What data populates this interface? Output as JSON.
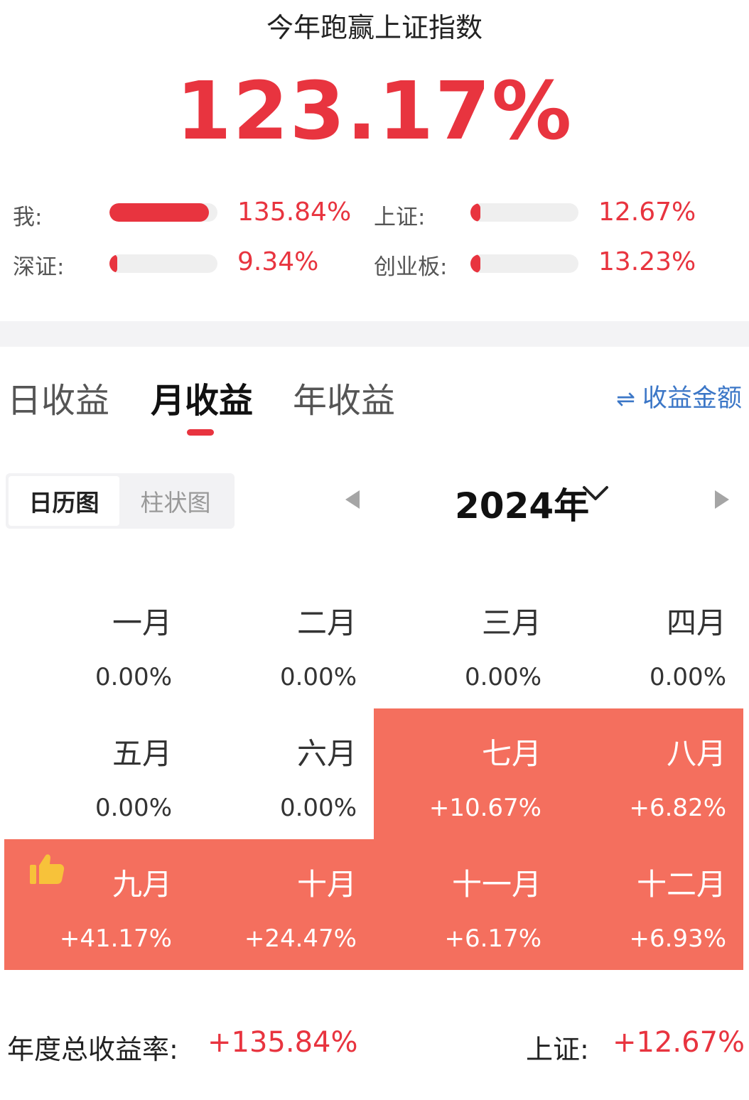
{
  "header": {
    "title": "今年跑赢上证指数",
    "value": "123.17%"
  },
  "comparisons": [
    {
      "label": "我:",
      "value": "135.84%",
      "fraction": 0.92
    },
    {
      "label": "上证:",
      "value": "12.67%",
      "fraction": 0.09
    },
    {
      "label": "深证:",
      "value": "9.34%",
      "fraction": 0.07
    },
    {
      "label": "创业板:",
      "value": "13.23%",
      "fraction": 0.09
    }
  ],
  "tabs": [
    "日收益",
    "月收益",
    "年收益"
  ],
  "active_tab": "月收益",
  "amount_toggle": {
    "icon": "swap-arrows-icon",
    "label": "收益金额"
  },
  "view_toggle": {
    "calendar": "日历图",
    "bar": "柱状图",
    "active": "日历图"
  },
  "year_selector": {
    "label": "2024年"
  },
  "months": [
    {
      "name": "一月",
      "value": "0.00%",
      "highlight": false
    },
    {
      "name": "二月",
      "value": "0.00%",
      "highlight": false
    },
    {
      "name": "三月",
      "value": "0.00%",
      "highlight": false
    },
    {
      "name": "四月",
      "value": "0.00%",
      "highlight": false
    },
    {
      "name": "五月",
      "value": "0.00%",
      "highlight": false
    },
    {
      "name": "六月",
      "value": "0.00%",
      "highlight": false
    },
    {
      "name": "七月",
      "value": "+10.67%",
      "highlight": true
    },
    {
      "name": "八月",
      "value": "+6.82%",
      "highlight": true
    },
    {
      "name": "九月",
      "value": "+41.17%",
      "highlight": true,
      "icon": "thumbs-up-icon"
    },
    {
      "name": "十月",
      "value": "+24.47%",
      "highlight": true
    },
    {
      "name": "十一月",
      "value": "+6.17%",
      "highlight": true
    },
    {
      "name": "十二月",
      "value": "+6.93%",
      "highlight": true
    }
  ],
  "footer": {
    "total_label": "年度总收益率:",
    "total_value": "+135.84%",
    "index_label": "上证:",
    "index_value": "+12.67%"
  },
  "colors": {
    "accent": "#e8343f",
    "month_highlight": "#f46f5e",
    "link": "#3c77c7"
  }
}
